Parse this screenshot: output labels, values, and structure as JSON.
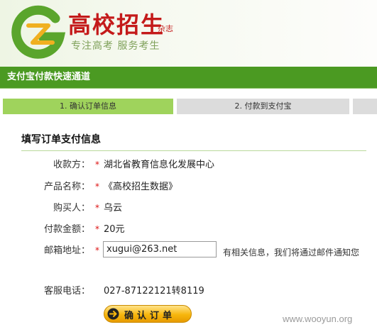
{
  "header": {
    "brand_title": "高校招生",
    "brand_sub": "杂志",
    "tagline": "专注高考 服务考生"
  },
  "titlebar": {
    "title": "支付宝付款快速通道"
  },
  "steps": [
    {
      "label": "1. 确认订单信息",
      "active": true
    },
    {
      "label": "2. 付款到支付宝",
      "active": false
    }
  ],
  "form": {
    "section_title": "填写订单支付信息",
    "payee": {
      "label": "收款方：",
      "value": "湖北省教育信息化发展中心"
    },
    "product": {
      "label": "产品名称：",
      "value": "《高校招生数据》"
    },
    "buyer": {
      "label": "购买人：",
      "value": "乌云"
    },
    "amount": {
      "label": "付款金额：",
      "value": "20元"
    },
    "email": {
      "label": "邮箱地址：",
      "value": "xugui@263.net",
      "hint": "有相关信息，我们将通过邮件通知您"
    },
    "service_phone": {
      "label": "客服电话：",
      "value": "027-87122121转8119"
    },
    "required_mark": "*"
  },
  "confirm_button": {
    "label": "确认订单"
  },
  "watermark": "www.wooyun.org",
  "colors": {
    "brand_green": "#4b9a22",
    "active_step": "#9fd35c",
    "inactive_step": "#dcdcdc",
    "brand_red": "#c41a1a",
    "button_orange": "#f7b60d"
  },
  "icons": [
    "brand-logo-icon",
    "arrow-right-circle-icon"
  ]
}
